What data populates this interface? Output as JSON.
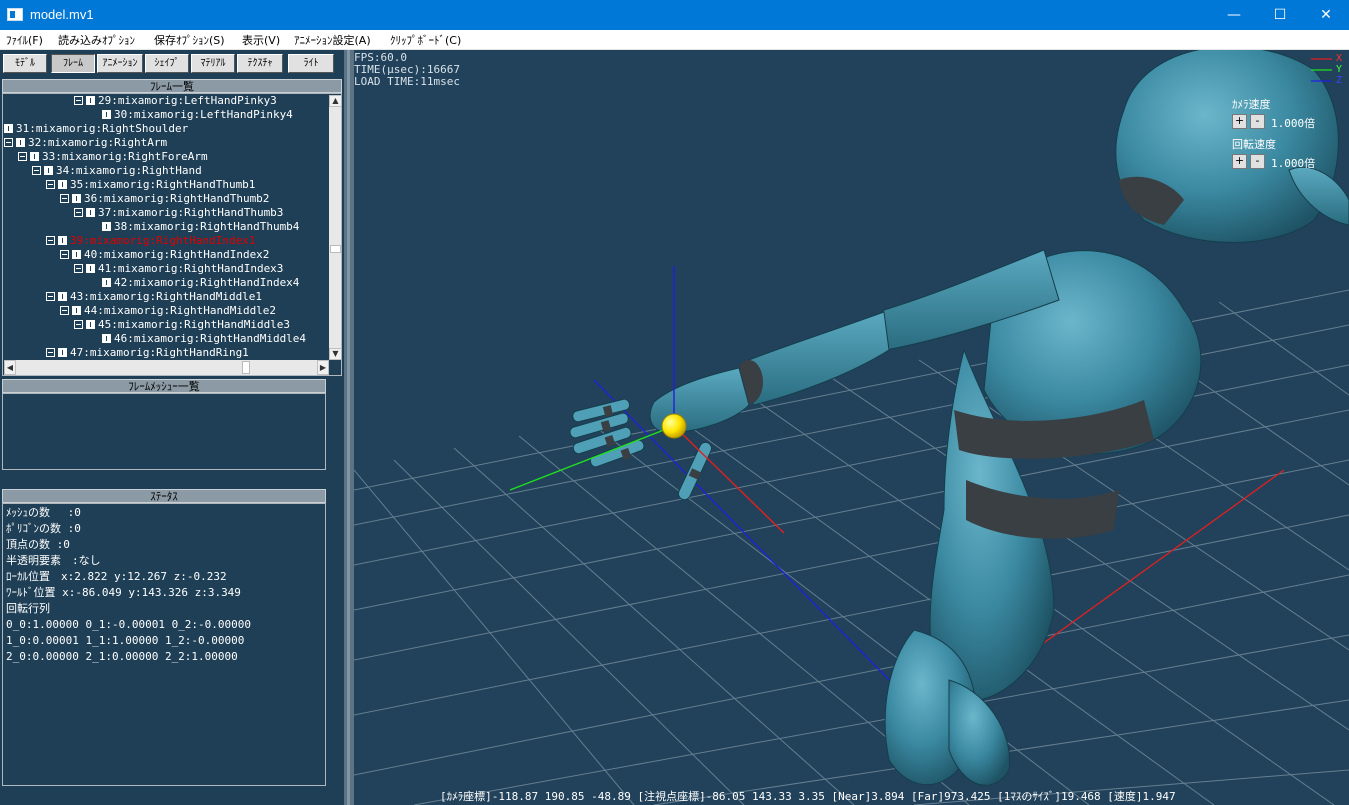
{
  "window": {
    "title": "model.mv1",
    "minimize": "—",
    "maximize": "☐",
    "close": "✕"
  },
  "menu": [
    "ﾌｧｲﾙ(F)",
    "読み込みｵﾌﾟｼｮﾝ",
    "保存ｵﾌﾟｼｮﾝ(S)",
    "表示(V)",
    "ｱﾆﾒｰｼｮﾝ設定(A)",
    "ｸﾘｯﾌﾟﾎﾞｰﾄﾞ(C)"
  ],
  "tabs": [
    "ﾓﾃﾞﾙ",
    "ﾌﾚｰﾑ",
    "ｱﾆﾒｰｼｮﾝ",
    "ｼｪｲﾌﾟ",
    "ﾏﾃﾘｱﾙ",
    "ﾃｸｽﾁｬ",
    "ﾗｲﾄ"
  ],
  "frame_list": {
    "header": "ﾌﾚｰﾑ一覧",
    "rows": [
      "29:mixamorig:LeftHandPinky3",
      "30:mixamorig:LeftHandPinky4",
      "31:mixamorig:RightShoulder",
      "32:mixamorig:RightArm",
      "33:mixamorig:RightForeArm",
      "34:mixamorig:RightHand",
      "35:mixamorig:RightHandThumb1",
      "36:mixamorig:RightHandThumb2",
      "37:mixamorig:RightHandThumb3",
      "38:mixamorig:RightHandThumb4",
      "39:mixamorig:RightHandIndex1",
      "40:mixamorig:RightHandIndex2",
      "41:mixamorig:RightHandIndex3",
      "42:mixamorig:RightHandIndex4",
      "43:mixamorig:RightHandMiddle1",
      "44:mixamorig:RightHandMiddle2",
      "45:mixamorig:RightHandMiddle3",
      "46:mixamorig:RightHandMiddle4",
      "47:mixamorig:RightHandRing1"
    ]
  },
  "mesh_list": {
    "header": "ﾌﾚｰﾑﾒｯｼｭｰ一覧"
  },
  "status": {
    "header": "ｽﾃｰﾀｽ",
    "lines": [
      "ﾒｯｼｭの数　 :0",
      "ﾎﾟﾘｺﾞﾝの数 :0",
      "頂点の数 :0",
      "半透明要素　:なし",
      "ﾛｰｶﾙ位置　x:2.822 y:12.267 z:-0.232",
      "ﾜｰﾙﾄﾞ位置 x:-86.049 y:143.326 z:3.349",
      "回転行列",
      "0_0:1.00000 0_1:-0.00001 0_2:-0.00000",
      "1_0:0.00001 1_1:1.00000 1_2:-0.00000",
      "2_0:0.00000 2_1:0.00000 2_2:1.00000"
    ]
  },
  "viewport": {
    "fps": "FPS:60.0",
    "time": "TIME(μsec):16667",
    "load_time": "LOAD TIME:11msec",
    "axis_x": "X",
    "axis_y": "Y",
    "axis_z": "Z",
    "camera_speed_label": "ｶﾒﾗ速度",
    "camera_speed_value": "1.000倍",
    "rotation_speed_label": "回転速度",
    "rotation_speed_value": "1.000倍",
    "plus": "+",
    "minus": "-",
    "bottom_status": "[ｶﾒﾗ座標]-118.87 190.85 -48.89 [注視点座標]-86.05 143.33 3.35 [Near]3.894 [Far]973.425 [1ﾏｽのｻｲｽﾞ]19.468 [速度]1.947"
  },
  "colors": {
    "viewport_bg": "#21425a",
    "model": "#3e8ba3",
    "axis_x": "#e02020",
    "axis_y": "#20e020",
    "axis_z": "#2020e0",
    "selected_joint": "#ffee00",
    "selected_text": "#e00000"
  }
}
